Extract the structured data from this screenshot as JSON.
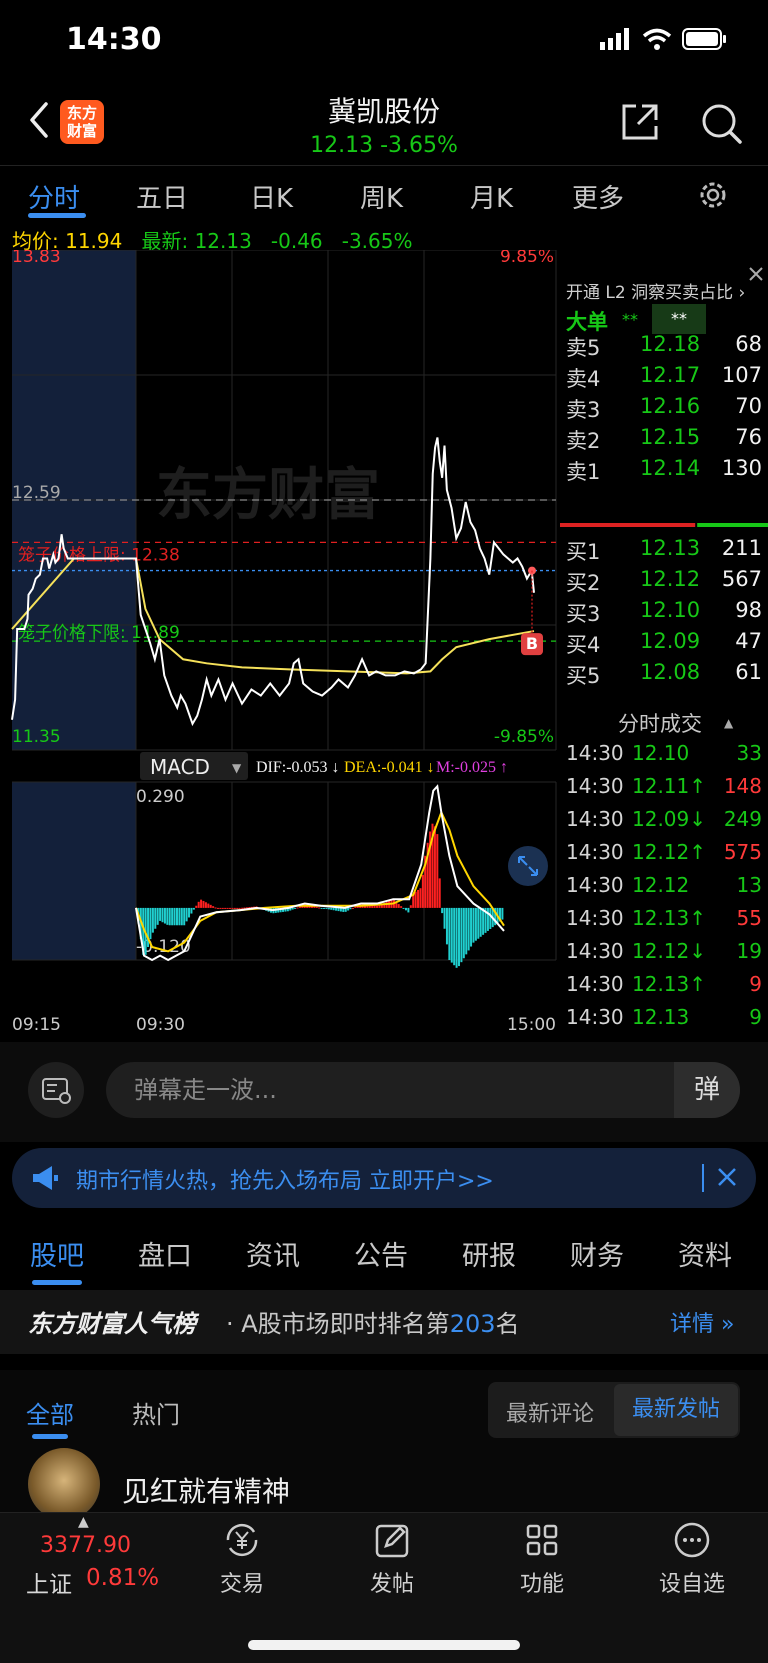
{
  "status": {
    "time": "14:30"
  },
  "header": {
    "logo_text": "东方财富",
    "name": "冀凯股份",
    "price_line": "12.13  -3.65%"
  },
  "chart_tabs": [
    "分时",
    "五日",
    "日K",
    "周K",
    "月K",
    "更多"
  ],
  "info": {
    "avg_label": "均价:",
    "avg_value": "11.94",
    "latest_label": "最新:",
    "latest_value": "12.13",
    "change": "-0.46",
    "pct": "-3.65%"
  },
  "chart_data": [
    {
      "type": "line",
      "title": "",
      "y_top_label": "13.83",
      "y_bottom_label": "11.35",
      "pct_top_label": "9.85%",
      "pct_bottom_label": "-9.85%",
      "ylim": [
        11.35,
        13.83
      ],
      "prev_close": 12.59,
      "prev_close_label": "12.59",
      "upper_limit_label": "笼子价格上限:  12.38",
      "upper_limit": 12.38,
      "lower_limit_label": "笼子价格下限:  11.89",
      "lower_limit": 11.89,
      "watermark": "东方财富",
      "marker": "B",
      "series": [
        {
          "kind": "price",
          "color": "#ffffff",
          "points": [
            [
              0,
              11.5
            ],
            [
              3,
              11.6
            ],
            [
              5,
              11.95
            ],
            [
              12,
              11.95
            ],
            [
              15,
              12.0
            ],
            [
              16,
              12.12
            ],
            [
              20,
              12.15
            ],
            [
              23,
              12.2
            ],
            [
              27,
              12.22
            ],
            [
              30,
              12.3
            ],
            [
              34,
              12.3
            ],
            [
              36,
              12.25
            ],
            [
              40,
              12.32
            ],
            [
              42,
              12.28
            ],
            [
              45,
              12.3
            ],
            [
              48,
              12.42
            ],
            [
              50,
              12.35
            ],
            [
              54,
              12.3
            ],
            [
              56,
              12.3
            ],
            [
              60,
              12.3
            ],
            [
              120,
              12.3
            ],
            [
              124,
              12.02
            ],
            [
              128,
              11.95
            ],
            [
              132,
              11.88
            ],
            [
              136,
              11.8
            ],
            [
              140,
              11.9
            ],
            [
              144,
              11.72
            ],
            [
              150,
              11.62
            ],
            [
              155,
              11.56
            ],
            [
              158,
              11.62
            ],
            [
              162,
              11.58
            ],
            [
              168,
              11.48
            ],
            [
              172,
              11.52
            ],
            [
              176,
              11.6
            ],
            [
              180,
              11.7
            ],
            [
              184,
              11.62
            ],
            [
              190,
              11.7
            ],
            [
              196,
              11.6
            ],
            [
              202,
              11.68
            ],
            [
              210,
              11.58
            ],
            [
              218,
              11.65
            ],
            [
              226,
              11.62
            ],
            [
              234,
              11.68
            ],
            [
              242,
              11.62
            ],
            [
              250,
              11.68
            ],
            [
              254,
              11.78
            ],
            [
              258,
              11.8
            ],
            [
              262,
              11.68
            ],
            [
              270,
              11.64
            ],
            [
              278,
              11.62
            ],
            [
              286,
              11.66
            ],
            [
              292,
              11.7
            ],
            [
              300,
              11.66
            ],
            [
              306,
              11.72
            ],
            [
              312,
              11.8
            ],
            [
              318,
              11.72
            ],
            [
              324,
              11.74
            ],
            [
              332,
              11.72
            ],
            [
              340,
              11.72
            ],
            [
              348,
              11.74
            ],
            [
              356,
              11.73
            ],
            [
              362,
              11.75
            ],
            [
              366,
              11.78
            ],
            [
              370,
              12.3
            ],
            [
              372,
              12.72
            ],
            [
              374,
              12.85
            ],
            [
              376,
              12.9
            ],
            [
              378,
              12.78
            ],
            [
              380,
              12.7
            ],
            [
              382,
              12.86
            ],
            [
              384,
              12.64
            ],
            [
              388,
              12.55
            ],
            [
              392,
              12.4
            ],
            [
              396,
              12.45
            ],
            [
              400,
              12.58
            ],
            [
              404,
              12.48
            ],
            [
              408,
              12.44
            ],
            [
              412,
              12.35
            ],
            [
              416,
              12.3
            ],
            [
              420,
              12.22
            ],
            [
              424,
              12.38
            ],
            [
              428,
              12.35
            ],
            [
              432,
              12.32
            ],
            [
              436,
              12.3
            ],
            [
              440,
              12.28
            ],
            [
              444,
              12.3
            ],
            [
              448,
              12.26
            ],
            [
              452,
              12.2
            ],
            [
              456,
              12.24
            ],
            [
              458,
              12.13
            ]
          ]
        },
        {
          "kind": "average",
          "color": "#f5e15a",
          "points": [
            [
              0,
              11.95
            ],
            [
              60,
              12.3
            ],
            [
              120,
              12.3
            ],
            [
              128,
              12.05
            ],
            [
              140,
              11.9
            ],
            [
              160,
              11.8
            ],
            [
              180,
              11.78
            ],
            [
              210,
              11.76
            ],
            [
              250,
              11.75
            ],
            [
              300,
              11.74
            ],
            [
              350,
              11.73
            ],
            [
              370,
              11.74
            ],
            [
              380,
              11.8
            ],
            [
              392,
              11.86
            ],
            [
              420,
              11.9
            ],
            [
              458,
              11.94
            ]
          ]
        }
      ]
    },
    {
      "type": "bar",
      "title": "MACD",
      "indicator_label": "MACD",
      "dif_label": "DIF:-0.053 ↓",
      "dea_label": "DEA:-0.041 ↓",
      "m_label": "M:-0.025 ↑",
      "y_top_label": "0.290",
      "y_bottom_label": "-0.120",
      "ylim": [
        -0.12,
        0.29
      ],
      "series": [
        {
          "name": "DIF",
          "color": "#ffffff",
          "points": [
            [
              0,
              0
            ],
            [
              10,
              -0.11
            ],
            [
              20,
              -0.12
            ],
            [
              30,
              -0.11
            ],
            [
              40,
              -0.12
            ],
            [
              60,
              -0.1
            ],
            [
              80,
              -0.02
            ],
            [
              100,
              -0.01
            ],
            [
              130,
              -0.005
            ],
            [
              150,
              0.0
            ],
            [
              170,
              -0.005
            ],
            [
              190,
              0.0
            ],
            [
              210,
              0.01
            ],
            [
              230,
              0.005
            ],
            [
              260,
              0.0
            ],
            [
              280,
              0.01
            ],
            [
              300,
              0.01
            ],
            [
              320,
              0.02
            ],
            [
              340,
              0.02
            ],
            [
              355,
              0.1
            ],
            [
              365,
              0.22
            ],
            [
              370,
              0.27
            ],
            [
              375,
              0.28
            ],
            [
              380,
              0.22
            ],
            [
              390,
              0.12
            ],
            [
              400,
              0.05
            ],
            [
              420,
              0.01
            ],
            [
              440,
              -0.015
            ],
            [
              458,
              -0.053
            ]
          ]
        },
        {
          "name": "DEA",
          "color": "#ffd600",
          "points": [
            [
              0,
              0
            ],
            [
              10,
              -0.05
            ],
            [
              20,
              -0.09
            ],
            [
              40,
              -0.1
            ],
            [
              60,
              -0.08
            ],
            [
              80,
              -0.03
            ],
            [
              100,
              -0.01
            ],
            [
              130,
              -0.005
            ],
            [
              160,
              0.0
            ],
            [
              200,
              0.005
            ],
            [
              240,
              0.005
            ],
            [
              280,
              0.005
            ],
            [
              320,
              0.01
            ],
            [
              345,
              0.03
            ],
            [
              360,
              0.1
            ],
            [
              370,
              0.17
            ],
            [
              380,
              0.22
            ],
            [
              390,
              0.18
            ],
            [
              400,
              0.12
            ],
            [
              420,
              0.05
            ],
            [
              440,
              0.01
            ],
            [
              458,
              -0.041
            ]
          ]
        }
      ],
      "time_labels": [
        "09:15",
        "09:30",
        "15:00"
      ]
    }
  ],
  "order_book": {
    "promo": "开通 L2 洞察买卖占比",
    "dadan_label": "大单",
    "dadan_v1": "**",
    "dadan_v2": "**",
    "asks": [
      {
        "label": "卖5",
        "price": "12.18",
        "vol": "68"
      },
      {
        "label": "卖4",
        "price": "12.17",
        "vol": "107"
      },
      {
        "label": "卖3",
        "price": "12.16",
        "vol": "70"
      },
      {
        "label": "卖2",
        "price": "12.15",
        "vol": "76"
      },
      {
        "label": "卖1",
        "price": "12.14",
        "vol": "130"
      }
    ],
    "bids": [
      {
        "label": "买1",
        "price": "12.13",
        "vol": "211"
      },
      {
        "label": "买2",
        "price": "12.12",
        "vol": "567"
      },
      {
        "label": "买3",
        "price": "12.10",
        "vol": "98"
      },
      {
        "label": "买4",
        "price": "12.09",
        "vol": "47"
      },
      {
        "label": "买5",
        "price": "12.08",
        "vol": "61"
      }
    ],
    "buy_ratio": 0.65,
    "ticks_title": "分时成交",
    "ticks": [
      {
        "time": "14:30",
        "price": "12.10",
        "vol": "33",
        "price_color": "#17c817",
        "vol_color": "#17c817"
      },
      {
        "time": "14:30",
        "price": "12.11↑",
        "vol": "148",
        "price_color": "#17c817",
        "vol_color": "#ff3a3a"
      },
      {
        "time": "14:30",
        "price": "12.09↓",
        "vol": "249",
        "price_color": "#17c817",
        "vol_color": "#17c817"
      },
      {
        "time": "14:30",
        "price": "12.12↑",
        "vol": "575",
        "price_color": "#17c817",
        "vol_color": "#ff3a3a"
      },
      {
        "time": "14:30",
        "price": "12.12",
        "vol": "13",
        "price_color": "#17c817",
        "vol_color": "#17c817"
      },
      {
        "time": "14:30",
        "price": "12.13↑",
        "vol": "55",
        "price_color": "#17c817",
        "vol_color": "#ff3a3a"
      },
      {
        "time": "14:30",
        "price": "12.12↓",
        "vol": "19",
        "price_color": "#17c817",
        "vol_color": "#17c817"
      },
      {
        "time": "14:30",
        "price": "12.13↑",
        "vol": "9",
        "price_color": "#17c817",
        "vol_color": "#ff3a3a"
      },
      {
        "time": "14:30",
        "price": "12.13",
        "vol": "9",
        "price_color": "#17c817",
        "vol_color": "#17c817"
      }
    ]
  },
  "danmu": {
    "placeholder": "弹幕走一波...",
    "send": "弹"
  },
  "ad": {
    "text": "期市行情火热，抢先入场布局 立即开户>>"
  },
  "bottom_tabs": [
    "股吧",
    "盘口",
    "资讯",
    "公告",
    "研报",
    "财务",
    "资料"
  ],
  "ranking": {
    "title": "东方财富人气榜",
    "prefix": "· A股市场即时排名第",
    "rank": "203",
    "suffix": "名",
    "detail": "详情 »"
  },
  "feed": {
    "tab_all": "全部",
    "tab_hot": "热门",
    "sort_comment": "最新评论",
    "sort_post": "最新发帖",
    "post_title": "见红就有精神"
  },
  "bottom_nav": {
    "index_value": "3377.90",
    "index_name": "上证",
    "index_change": "0.81%",
    "items": [
      {
        "label": "交易",
        "icon": "yen-cycle-icon"
      },
      {
        "label": "发帖",
        "icon": "edit-icon"
      },
      {
        "label": "功能",
        "icon": "grid-icon"
      },
      {
        "label": "设自选",
        "icon": "more-dots-icon"
      }
    ]
  },
  "colors": {
    "accent": "#3b8ef0",
    "up": "#ff3a3a",
    "down": "#17c817",
    "avg": "#f5e15a"
  }
}
